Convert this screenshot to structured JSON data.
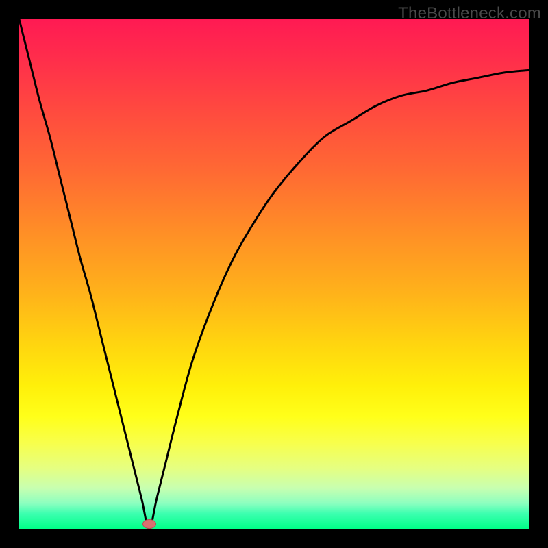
{
  "watermark": "TheBottleneck.com",
  "chart_data": {
    "type": "line",
    "title": "",
    "xlabel": "",
    "ylabel": "",
    "xlim": [
      0,
      1
    ],
    "ylim": [
      0,
      1
    ],
    "grid": false,
    "legend": false,
    "marker": {
      "x": 0.255,
      "y": 0.01
    },
    "colors": {
      "curve": "#000000",
      "marker_fill": "#d87070",
      "marker_stroke": "#b84d55",
      "gradient_top": "#ff1a53",
      "gradient_bottom": "#00ff88",
      "frame": "#000000"
    },
    "series": [
      {
        "name": "curve",
        "x": [
          0.0,
          0.02,
          0.04,
          0.06,
          0.08,
          0.1,
          0.12,
          0.14,
          0.16,
          0.18,
          0.2,
          0.22,
          0.24,
          0.255,
          0.27,
          0.29,
          0.31,
          0.34,
          0.38,
          0.42,
          0.46,
          0.5,
          0.55,
          0.6,
          0.65,
          0.7,
          0.75,
          0.8,
          0.85,
          0.9,
          0.95,
          1.0
        ],
        "y": [
          1.0,
          0.92,
          0.84,
          0.77,
          0.69,
          0.61,
          0.53,
          0.46,
          0.38,
          0.3,
          0.22,
          0.14,
          0.06,
          0.0,
          0.06,
          0.14,
          0.22,
          0.33,
          0.44,
          0.53,
          0.6,
          0.66,
          0.72,
          0.77,
          0.8,
          0.83,
          0.85,
          0.86,
          0.875,
          0.885,
          0.895,
          0.9
        ]
      }
    ]
  }
}
